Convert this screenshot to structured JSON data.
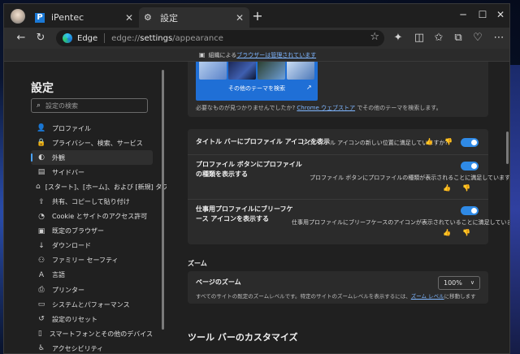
{
  "tabs": [
    {
      "label": "iPentec",
      "favicon": "iPentec-logo-icon"
    },
    {
      "label": "設定",
      "favicon": "gear-icon"
    }
  ],
  "toolbar": {
    "brand": "Edge",
    "url_scheme": "edge://",
    "url_host": "settings",
    "url_path": "/appearance"
  },
  "managed_bar": {
    "prefix": "組織による",
    "link": "ブラウザーは管理されています"
  },
  "sidebar": {
    "title": "設定",
    "search_placeholder": "設定の検索",
    "items": [
      {
        "label": "プロファイル",
        "icon": "person-icon"
      },
      {
        "label": "プライバシー、検索、サービス",
        "icon": "lock-icon"
      },
      {
        "label": "外観",
        "icon": "palette-icon",
        "active": true
      },
      {
        "label": "サイドバー",
        "icon": "sidebar-icon"
      },
      {
        "label": "[スタート]、[ホーム]、および [新規] タブ",
        "icon": "home-icon"
      },
      {
        "label": "共有、コピーして貼り付け",
        "icon": "share-icon"
      },
      {
        "label": "Cookie とサイトのアクセス許可",
        "icon": "cookie-icon"
      },
      {
        "label": "既定のブラウザー",
        "icon": "browser-icon"
      },
      {
        "label": "ダウンロード",
        "icon": "download-icon"
      },
      {
        "label": "ファミリー セーフティ",
        "icon": "family-icon"
      },
      {
        "label": "言語",
        "icon": "language-icon"
      },
      {
        "label": "プリンター",
        "icon": "printer-icon"
      },
      {
        "label": "システムとパフォーマンス",
        "icon": "system-icon"
      },
      {
        "label": "設定のリセット",
        "icon": "reset-icon"
      },
      {
        "label": "スマートフォンとその他のデバイス",
        "icon": "phone-icon"
      },
      {
        "label": "アクセシビリティ",
        "icon": "accessibility-icon"
      }
    ]
  },
  "theme": {
    "more_themes": "その他のテーマを検索",
    "hint_prefix": "必要なものが見つかりませんでしたか?",
    "hint_link": "Chrome ウェブストア",
    "hint_suffix": "でその他のテーマを検索します。"
  },
  "profile_settings": [
    {
      "title": "タイトル バーにプロファイル アイコンを表示",
      "feedback": "プロフィール アイコンの新しい位置に満足していますか?",
      "enabled": true
    },
    {
      "title_line1": "プロファイル ボタンにプロファイル",
      "title_line2": "の種類を表示する",
      "feedback": "プロファイル ボタンにプロファイルの種類が表示されることに満足していますか?",
      "enabled": true
    },
    {
      "title_line1": "仕事用プロファイルにブリーフケ",
      "title_line2": "ース アイコンを表示する",
      "feedback": "仕事用プロファイルにブリーフケースのアイコンが表示されていることに満足していますか?",
      "enabled": true
    }
  ],
  "zoom": {
    "section_title": "ズーム",
    "label": "ページのズーム",
    "description": "すべてのサイトの既定のズームレベルです。特定のサイトのズームレベルを表示するには、",
    "link": "ズーム レベル",
    "description_suffix": "に移動します",
    "value": "100%"
  },
  "toolbar_section": {
    "title": "ツール バーのカスタマイズ"
  },
  "colors": {
    "accent": "#2f8ae6",
    "link": "#7fb6ff",
    "background": "#202020",
    "card": "#2b2b2b"
  }
}
